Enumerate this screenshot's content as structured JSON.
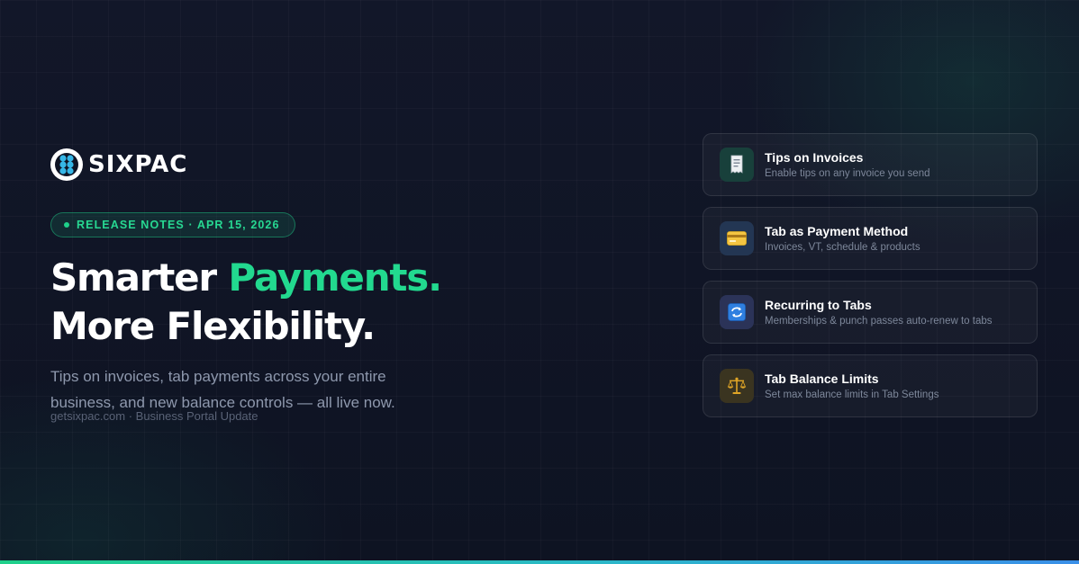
{
  "brand": {
    "name": "SIXPAC"
  },
  "badge": {
    "text": "RELEASE NOTES · APR 15, 2026"
  },
  "headline": {
    "line1_prefix": "Smarter ",
    "line1_accent": "Payments.",
    "line2": "More Flexibility."
  },
  "subtext": "Tips on invoices, tab payments across your entire business, and new balance controls — all live now.",
  "footer": "getsixpac.com · Business Portal Update",
  "features": [
    {
      "title": "Tips on Invoices",
      "description": "Enable tips on any invoice you send",
      "icon": "receipt-icon",
      "icon_bg": "#18403b"
    },
    {
      "title": "Tab as Payment Method",
      "description": "Invoices, VT, schedule & products",
      "icon": "credit-card-icon",
      "icon_bg": "#233653"
    },
    {
      "title": "Recurring to Tabs",
      "description": "Memberships & punch passes auto-renew to tabs",
      "icon": "repeat-icon",
      "icon_bg": "#2b3358"
    },
    {
      "title": "Tab Balance Limits",
      "description": "Set max balance limits in Tab Settings",
      "icon": "balance-scale-icon",
      "icon_bg": "#3a3420"
    }
  ],
  "colors": {
    "accent": "#22d98f",
    "background": "#0f1424"
  }
}
